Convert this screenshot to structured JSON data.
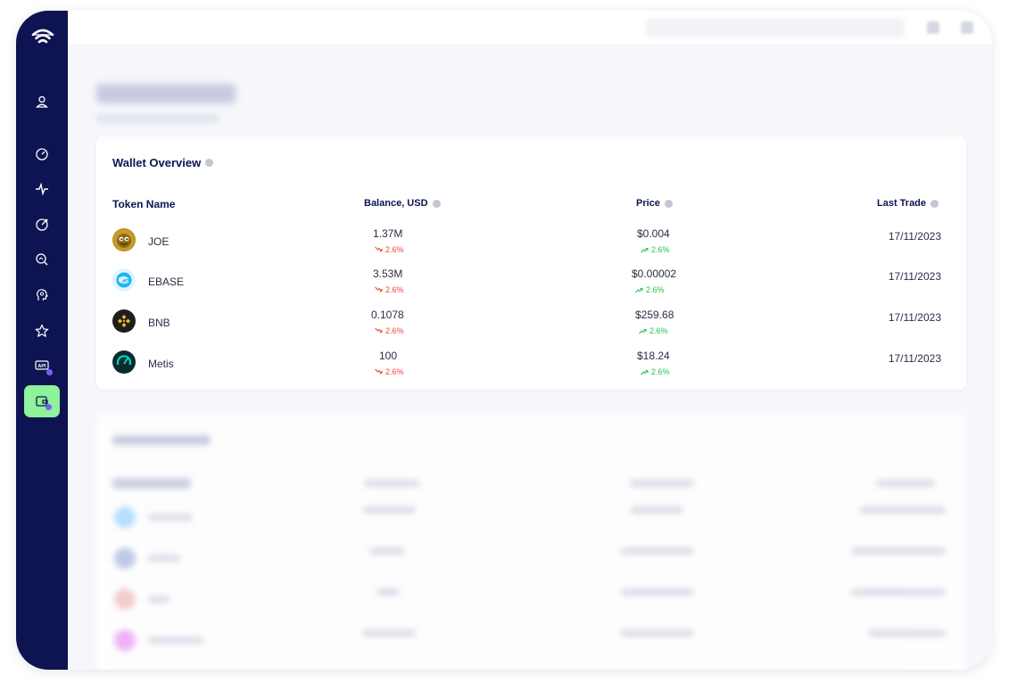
{
  "overview": {
    "title": "Wallet Overview",
    "headers": {
      "token": "Token Name",
      "balance": "Balance, USD",
      "price": "Price",
      "last_trade": "Last Trade"
    },
    "rows": [
      {
        "token": "JOE",
        "balance": "1.37M",
        "balance_change": "2.6%",
        "price": "$0.004",
        "price_change": "2.6%",
        "last_trade": "17/11/2023",
        "icon": "joe-token-icon"
      },
      {
        "token": "EBASE",
        "balance": "3.53M",
        "balance_change": "2.6%",
        "price": "$0.00002",
        "price_change": "2.6%",
        "last_trade": "17/11/2023",
        "icon": "ebase-token-icon"
      },
      {
        "token": "BNB",
        "balance": "0.1078",
        "balance_change": "2.6%",
        "price": "$259.68",
        "price_change": "2.6%",
        "last_trade": "17/11/2023",
        "icon": "bnb-token-icon"
      },
      {
        "token": "Metis",
        "balance": "100",
        "balance_change": "2.6%",
        "price": "$18.24",
        "price_change": "2.6%",
        "last_trade": "17/11/2023",
        "icon": "metis-token-icon"
      }
    ]
  },
  "colors": {
    "sidebar": "#0e1452",
    "active_nav": "#8ef39a",
    "down": "#f0443a",
    "up": "#27c24a",
    "badge": "#7b5cff"
  },
  "sidebar_icons": [
    "wifi-logo-icon",
    "user-icon",
    "gauge-icon",
    "activity-icon",
    "dial-icon",
    "search-chart-icon",
    "brain-icon",
    "star-icon",
    "api-icon",
    "wallet-icon"
  ]
}
